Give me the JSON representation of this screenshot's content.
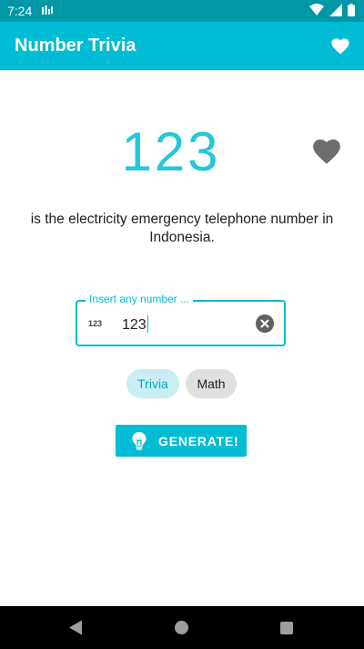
{
  "status_bar": {
    "time": "7:24"
  },
  "app_bar": {
    "title": "Number Trivia"
  },
  "trivia": {
    "number": "123",
    "text": "is the electricity emergency telephone number in Indonesia."
  },
  "input": {
    "label": "Insert any number ...",
    "prefix": "123",
    "value": "123"
  },
  "chips": [
    {
      "label": "Trivia",
      "selected": true
    },
    {
      "label": "Math",
      "selected": false
    }
  ],
  "generate_button": {
    "label": "GENERATE!"
  },
  "colors": {
    "primary": "#00bcd4",
    "primary_dark": "#0097a7",
    "number_text": "#26c6da",
    "chip_selected_bg": "#c8eef4"
  }
}
